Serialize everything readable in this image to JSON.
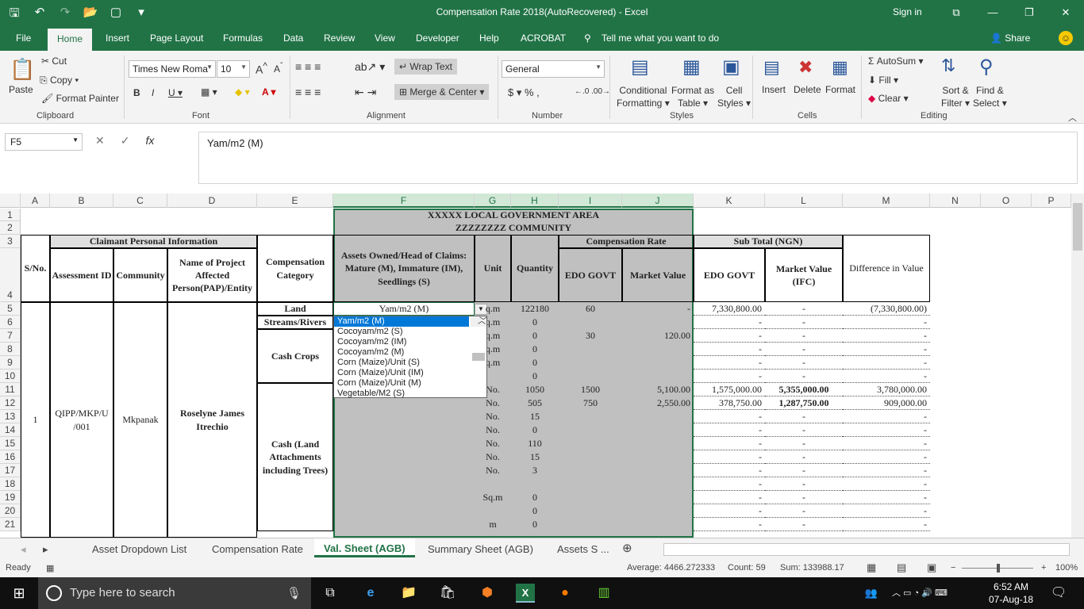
{
  "window": {
    "title": "Compensation Rate 2018(AutoRecovered)  -  Excel",
    "signin": "Sign in"
  },
  "tabs": [
    "File",
    "Home",
    "Insert",
    "Page Layout",
    "Formulas",
    "Data",
    "Review",
    "View",
    "Developer",
    "Help",
    "ACROBAT"
  ],
  "tell_me": "Tell me what you want to do",
  "share": "Share",
  "ribbon": {
    "paste": "Paste",
    "cut": "Cut",
    "copy": "Copy",
    "format_painter": "Format Painter",
    "font_name": "Times New Roma",
    "font_size": "10",
    "wrap_text": "Wrap Text",
    "merge_center": "Merge & Center",
    "number_format": "General",
    "conditional": "Conditional",
    "formatting": "Formatting",
    "format_as": "Format as",
    "table": "Table",
    "cell": "Cell",
    "styles_btn": "Styles",
    "insert": "Insert",
    "delete": "Delete",
    "format": "Format",
    "autosum": "AutoSum",
    "fill": "Fill",
    "clear": "Clear",
    "sort_filter": "Sort &",
    "filter": "Filter",
    "find_select": "Find &",
    "select": "Select",
    "groups": {
      "clipboard": "Clipboard",
      "font": "Font",
      "alignment": "Alignment",
      "number": "Number",
      "styles": "Styles",
      "cells": "Cells",
      "editing": "Editing"
    }
  },
  "formula_bar": {
    "name_box": "F5",
    "fx": "fx",
    "content": "Yam/m2 (M)"
  },
  "columns": [
    "A",
    "B",
    "C",
    "D",
    "E",
    "F",
    "G",
    "H",
    "I",
    "J",
    "K",
    "L",
    "M",
    "N",
    "O",
    "P"
  ],
  "rows": [
    "1",
    "2",
    "3",
    "4",
    "5",
    "6",
    "7",
    "8",
    "9",
    "10",
    "11",
    "12",
    "13",
    "14",
    "15",
    "16",
    "17",
    "18",
    "19",
    "20",
    "21"
  ],
  "sheet": {
    "title1": "XXXXX  LOCAL GOVERNMENT AREA",
    "title2": "ZZZZZZZZ  COMMUNITY",
    "hdr_claimant": "Claimant Personal Information",
    "hdr_compensation_rate": "Compensation Rate",
    "hdr_subtotal": "Sub Total (NGN)",
    "hdr_sno": "S/No.",
    "hdr_assessment": "Assessment ID",
    "hdr_community": "Community",
    "hdr_name": "Name of Project Affected Person(PAP)/Entity",
    "hdr_category": "Compensation Category",
    "hdr_assets": "Assets Owned/Head of Claims: Mature (M), Immature (IM), Seedlings (S)",
    "hdr_unit": "Unit",
    "hdr_quantity": "Quantity",
    "hdr_edo": "EDO GOVT",
    "hdr_market": "Market Value",
    "hdr_edo2": "EDO GOVT",
    "hdr_market2": "Market Value (IFC)",
    "hdr_diff": "Difference in Value",
    "sno": "1",
    "assessment_id": "QIPP/MKP/U /001",
    "community": "Mkpanak",
    "pap_name": "Roselyne James Itrechio",
    "cat_land": "Land",
    "cat_streams": "Streams/Rivers",
    "cat_cash": "Cash Crops",
    "cat_cash_land": "Cash (Land Attachments including Trees)",
    "f5_value": "Yam/m2 (M)",
    "data_rows": [
      {
        "unit": "q.m",
        "qty": "122180",
        "edo": "60",
        "mkt": "-",
        "k": "7,330,800.00",
        "l": "-",
        "m": "(7,330,800.00)"
      },
      {
        "unit": "q.m",
        "qty": "0",
        "edo": "",
        "mkt": "",
        "k": "-",
        "l": "-",
        "m": "-"
      },
      {
        "unit": "q.m",
        "qty": "0",
        "edo": "30",
        "mkt": "120.00",
        "k": "-",
        "l": "-",
        "m": "-"
      },
      {
        "unit": "q.m",
        "qty": "0",
        "edo": "",
        "mkt": "",
        "k": "-",
        "l": "-",
        "m": "-"
      },
      {
        "unit": "q.m",
        "qty": "0",
        "edo": "",
        "mkt": "",
        "k": "-",
        "l": "-",
        "m": "-"
      },
      {
        "unit": "",
        "qty": "0",
        "edo": "",
        "mkt": "",
        "k": "-",
        "l": "-",
        "m": "-"
      },
      {
        "unit": "No.",
        "qty": "1050",
        "edo": "1500",
        "mkt": "5,100.00",
        "k": "1,575,000.00",
        "l": "5,355,000.00",
        "m": "3,780,000.00"
      },
      {
        "unit": "No.",
        "qty": "505",
        "edo": "750",
        "mkt": "2,550.00",
        "k": "378,750.00",
        "l": "1,287,750.00",
        "m": "909,000.00"
      },
      {
        "unit": "No.",
        "qty": "15",
        "edo": "",
        "mkt": "",
        "k": "-",
        "l": "-",
        "m": "-"
      },
      {
        "unit": "No.",
        "qty": "0",
        "edo": "",
        "mkt": "",
        "k": "-",
        "l": "-",
        "m": "-"
      },
      {
        "unit": "No.",
        "qty": "110",
        "edo": "",
        "mkt": "",
        "k": "-",
        "l": "-",
        "m": "-"
      },
      {
        "unit": "No.",
        "qty": "15",
        "edo": "",
        "mkt": "",
        "k": "-",
        "l": "-",
        "m": "-"
      },
      {
        "unit": "No.",
        "qty": "3",
        "edo": "",
        "mkt": "",
        "k": "-",
        "l": "-",
        "m": "-"
      },
      {
        "unit": "",
        "qty": "",
        "edo": "",
        "mkt": "",
        "k": "-",
        "l": "-",
        "m": "-"
      },
      {
        "unit": "Sq.m",
        "qty": "0",
        "edo": "",
        "mkt": "",
        "k": "-",
        "l": "-",
        "m": "-"
      },
      {
        "unit": "",
        "qty": "0",
        "edo": "",
        "mkt": "",
        "k": "-",
        "l": "-",
        "m": "-"
      },
      {
        "unit": "m",
        "qty": "0",
        "edo": "",
        "mkt": "",
        "k": "-",
        "l": "-",
        "m": "-"
      }
    ],
    "dropdown": [
      "Yam/m2 (M)",
      "Cocoyam/m2 (S)",
      "Cocoyam/m2 (IM)",
      "Cocoyam/m2 (M)",
      "Corn (Maize)/Unit (S)",
      "Corn (Maize)/Unit (IM)",
      "Corn (Maize)/Unit (M)",
      "Vegetable/M2 (S)"
    ]
  },
  "sheet_tabs": [
    "Asset Dropdown List",
    "Compensation Rate",
    "Val. Sheet (AGB)",
    "Summary Sheet (AGB)",
    "Assets S ..."
  ],
  "status": {
    "ready": "Ready",
    "average": "Average: 4466.272333",
    "count": "Count: 59",
    "sum": "Sum: 133988.17",
    "zoom": "100%"
  },
  "taskbar": {
    "search": "Type here to search",
    "time": "6:52 AM",
    "date": "07-Aug-18"
  }
}
